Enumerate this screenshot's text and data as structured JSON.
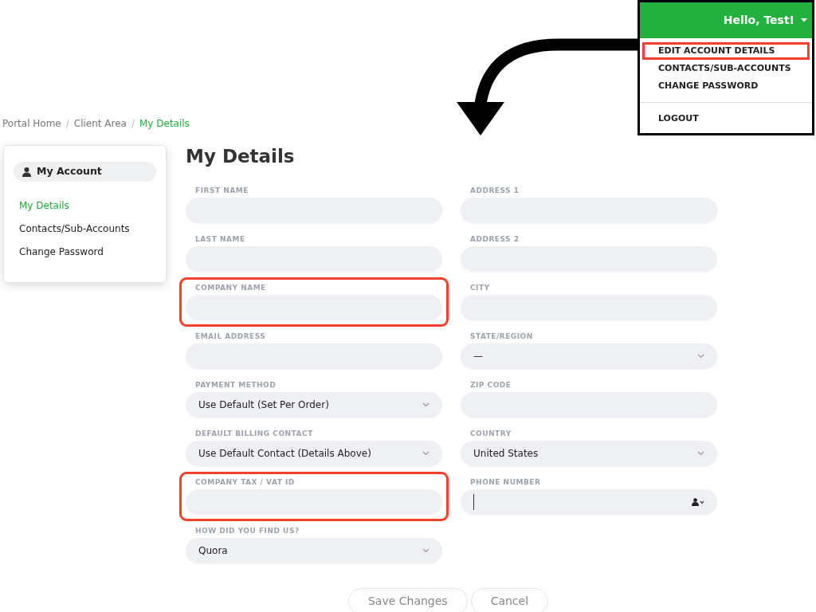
{
  "breadcrumb": [
    {
      "kind": "link",
      "label": "Portal Home",
      "selected": false
    },
    {
      "kind": "separator",
      "label": "/"
    },
    {
      "kind": "link",
      "label": "Client Area",
      "selected": false
    },
    {
      "kind": "separator",
      "label": "/"
    },
    {
      "kind": "link",
      "label": "My Details",
      "selected": true
    }
  ],
  "sidebar": {
    "title": "My Account",
    "items": [
      {
        "label": "My Details",
        "selected": true
      },
      {
        "label": "Contacts/Sub-Accounts",
        "selected": false
      },
      {
        "label": "Change Password",
        "selected": false
      }
    ]
  },
  "page_title": "My Details",
  "fields": [
    {
      "label": "FIRST NAME",
      "kind": "text",
      "highlighted": false
    },
    {
      "label": "ADDRESS 1",
      "kind": "text",
      "highlighted": false
    },
    {
      "label": "LAST NAME",
      "kind": "text",
      "highlighted": false
    },
    {
      "label": "ADDRESS 2",
      "kind": "text",
      "highlighted": false
    },
    {
      "label": "COMPANY NAME",
      "kind": "text",
      "highlighted": true
    },
    {
      "label": "CITY",
      "kind": "text",
      "highlighted": false
    },
    {
      "label": "EMAIL ADDRESS",
      "kind": "text",
      "highlighted": false
    },
    {
      "label": "STATE/REGION",
      "kind": "select",
      "value": "—",
      "highlighted": false
    },
    {
      "label": "PAYMENT METHOD",
      "kind": "select",
      "value": "Use Default (Set Per Order)",
      "highlighted": false
    },
    {
      "label": "ZIP CODE",
      "kind": "text",
      "highlighted": false
    },
    {
      "label": "DEFAULT BILLING CONTACT",
      "kind": "select",
      "value": "Use Default Contact (Details Above)",
      "highlighted": false
    },
    {
      "label": "COUNTRY",
      "kind": "select",
      "value": "United States",
      "highlighted": false
    },
    {
      "label": "COMPANY TAX / VAT ID",
      "kind": "text",
      "highlighted": true
    },
    {
      "label": "PHONE NUMBER",
      "kind": "phone",
      "focused": true,
      "highlighted": false
    },
    {
      "label": "HOW DID YOU FIND US?",
      "kind": "select",
      "value": "Quora",
      "highlighted": false
    }
  ],
  "buttons": [
    "Save Changes",
    "Cancel"
  ],
  "user_menu": {
    "greeting": "Hello, Test!",
    "items": [
      {
        "label": "EDIT ACCOUNT DETAILS",
        "kind": "item",
        "highlighted": true
      },
      {
        "label": "CONTACTS/SUB-ACCOUNTS",
        "kind": "item",
        "highlighted": false
      },
      {
        "label": "CHANGE PASSWORD",
        "kind": "item",
        "highlighted": false
      },
      {
        "kind": "divider"
      },
      {
        "label": "LOGOUT",
        "kind": "item",
        "highlighted": false
      }
    ]
  }
}
